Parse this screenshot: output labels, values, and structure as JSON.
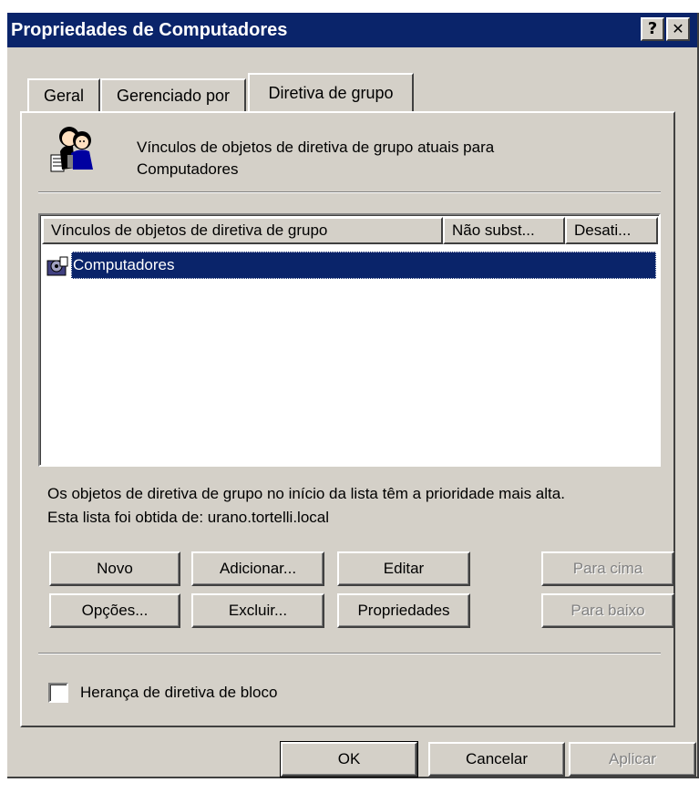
{
  "window": {
    "title": "Propriedades de Computadores",
    "help_button": "?",
    "close_button": "✕"
  },
  "tabs": [
    {
      "label": "Geral",
      "active": false
    },
    {
      "label": "Gerenciado por",
      "active": false
    },
    {
      "label": "Diretiva de grupo",
      "active": true
    }
  ],
  "header": {
    "icon": "users-group-icon",
    "description_line1": "Vínculos de objetos de diretiva de grupo atuais para",
    "description_line2": "Computadores"
  },
  "list": {
    "columns": [
      "Vínculos de objetos de diretiva de grupo",
      "Não subst...",
      "Desati..."
    ],
    "rows": [
      {
        "name": "Computadores",
        "icon": "gpo-icon",
        "selected": true
      }
    ]
  },
  "info": {
    "line1": "Os objetos de diretiva de grupo no início da lista têm a prioridade mais alta.",
    "line2": "Esta lista foi obtida de: urano.tortelli.local"
  },
  "buttons": {
    "novo": "Novo",
    "adicionar": "Adicionar...",
    "editar": "Editar",
    "para_cima": "Para cima",
    "opcoes": "Opções...",
    "excluir": "Excluir...",
    "propriedades": "Propriedades",
    "para_baixo": "Para baixo"
  },
  "checkbox": {
    "label": "Herança de diretiva de bloco",
    "checked": false
  },
  "footer": {
    "ok": "OK",
    "cancelar": "Cancelar",
    "aplicar": "Aplicar"
  },
  "colors": {
    "titlebar": "#0a246a",
    "face": "#d4d0c8",
    "selection": "#0a246a"
  }
}
